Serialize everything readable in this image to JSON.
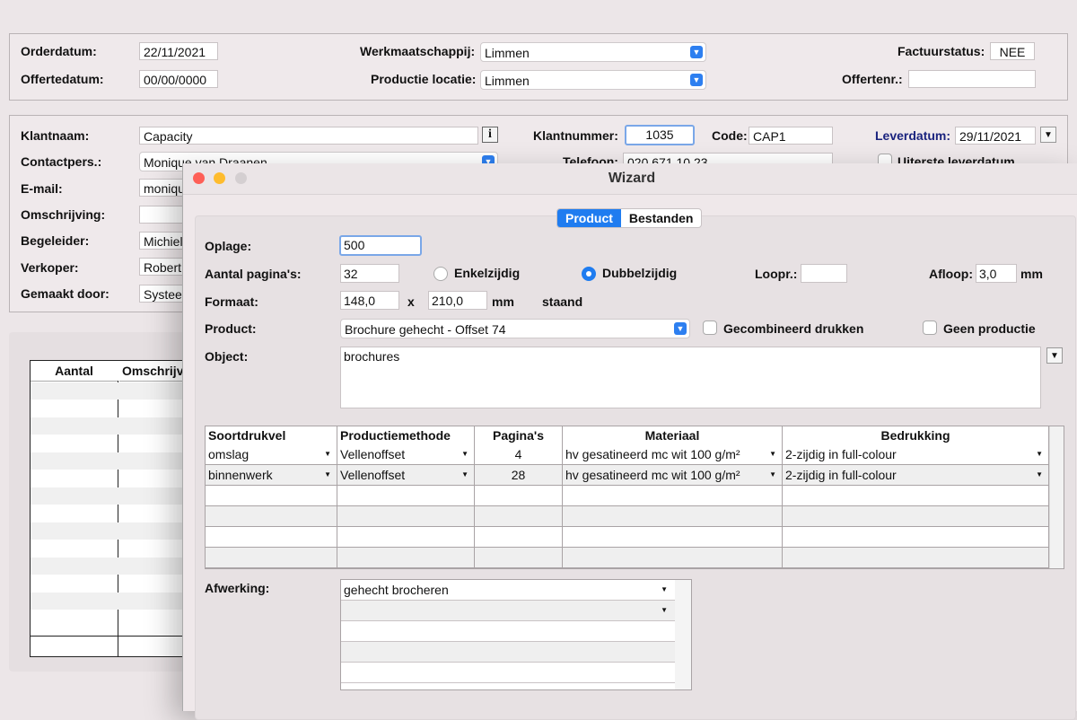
{
  "top": {
    "orderdatum_label": "Orderdatum:",
    "orderdatum_value": "22/11/2021",
    "offertedatum_label": "Offertedatum:",
    "offertedatum_value": "00/00/0000",
    "werkmaatschappij_label": "Werkmaatschappij:",
    "werkmaatschappij_value": "Limmen",
    "productielocatie_label": "Productie locatie:",
    "productielocatie_value": "Limmen",
    "factuurstatus_label": "Factuurstatus:",
    "factuurstatus_value": "NEE",
    "offertenr_label": "Offertenr.:",
    "offertenr_value": ""
  },
  "customer": {
    "klantnaam_label": "Klantnaam:",
    "klantnaam_value": "Capacity",
    "info_label": "i",
    "klantnummer_label": "Klantnummer:",
    "klantnummer_value": "1035",
    "code_label": "Code:",
    "code_value": "CAP1",
    "leverdatum_label": "Leverdatum:",
    "leverdatum_value": "29/11/2021",
    "contactpers_label": "Contactpers.:",
    "contactpers_value": "Monique van Draanen",
    "telefoon_label": "Telefoon:",
    "telefoon_value": "020 671 10 23",
    "uiterste_label": "Uiterste leverdatum",
    "email_label": "E-mail:",
    "email_value": "monique",
    "omschrijving_label": "Omschrijving:",
    "omschrijving_value": "",
    "begeleider_label": "Begeleider:",
    "begeleider_value": "Michiel",
    "verkoper_label": "Verkoper:",
    "verkoper_value": "Robert",
    "gemaakt_label": "Gemaakt door:",
    "gemaakt_value": "Systeem"
  },
  "left_grid": {
    "col_aantal": "Aantal",
    "col_omschrijving": "Omschrijving"
  },
  "wizard": {
    "title": "Wizard",
    "tabs": [
      {
        "label": "Product"
      },
      {
        "label": "Bestanden"
      }
    ],
    "oplage_label": "Oplage:",
    "oplage_value": "500",
    "aantal_paginas_label": "Aantal pagina's:",
    "aantal_paginas_value": "32",
    "enkelzijdig_label": "Enkelzijdig",
    "dubbelzijdig_label": "Dubbelzijdig",
    "loopr_label": "Loopr.:",
    "loopr_value": "",
    "afloop_label": "Afloop:",
    "afloop_value": "3,0",
    "afloop_unit": "mm",
    "formaat_label": "Formaat:",
    "formaat_w": "148,0",
    "formaat_x": "x",
    "formaat_h": "210,0",
    "formaat_unit": "mm",
    "formaat_orientation": "staand",
    "product_label": "Product:",
    "product_value": "Brochure gehecht - Offset 74",
    "gecombineerd_label": "Gecombineerd drukken",
    "geen_productie_label": "Geen productie",
    "object_label": "Object:",
    "object_value": "brochures",
    "table": {
      "headers": [
        "Soortdrukvel",
        "Productiemethode",
        "Pagina's",
        "Materiaal",
        "Bedrukking"
      ],
      "rows": [
        {
          "soort": "omslag",
          "methode": "Vellenoffset",
          "paginas": "4",
          "materiaal": "hv gesatineerd mc wit 100 g/m²",
          "bedrukking": "2-zijdig in full-colour"
        },
        {
          "soort": "binnenwerk",
          "methode": "Vellenoffset",
          "paginas": "28",
          "materiaal": "hv gesatineerd mc wit 100 g/m²",
          "bedrukking": "2-zijdig in full-colour"
        }
      ]
    },
    "afwerking_label": "Afwerking:",
    "afwerking_items": [
      "gehecht brocheren",
      ""
    ]
  },
  "colors": {
    "accent": "#1f7cf0",
    "leverdatum": "#1a237e",
    "close": "#fe5f57",
    "minimize": "#febc2e",
    "zoom": "#d4cfd1"
  }
}
